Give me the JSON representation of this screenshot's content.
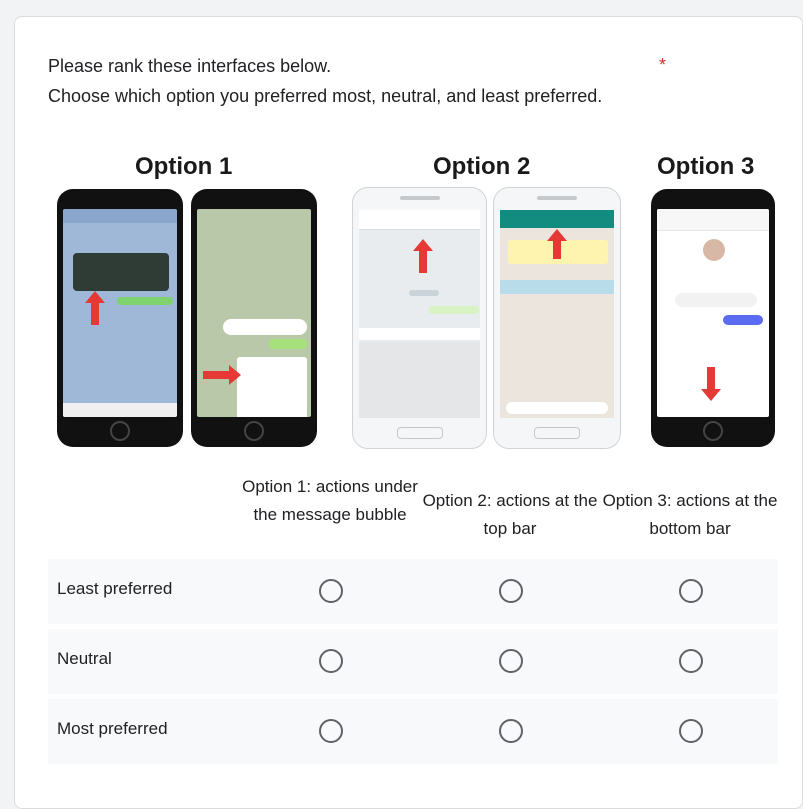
{
  "question": {
    "line1": "Please rank these interfaces below.",
    "line2": "Choose which option you preferred most, neutral, and least preferred.",
    "required_mark": "*"
  },
  "image": {
    "option_titles": [
      "Option 1",
      "Option 2",
      "Option 3"
    ]
  },
  "columns": [
    "Option 1: actions under the message bubble",
    "Option 2: actions at the top bar",
    "Option 3: actions at the bottom bar"
  ],
  "rows": [
    "Least preferred",
    "Neutral",
    "Most preferred"
  ],
  "colors": {
    "required": "#d93025",
    "radio_border": "#5f6368",
    "row_bg": "#f8f9fa",
    "arrow": "#e53935",
    "whatsapp_green": "#128c7e"
  }
}
